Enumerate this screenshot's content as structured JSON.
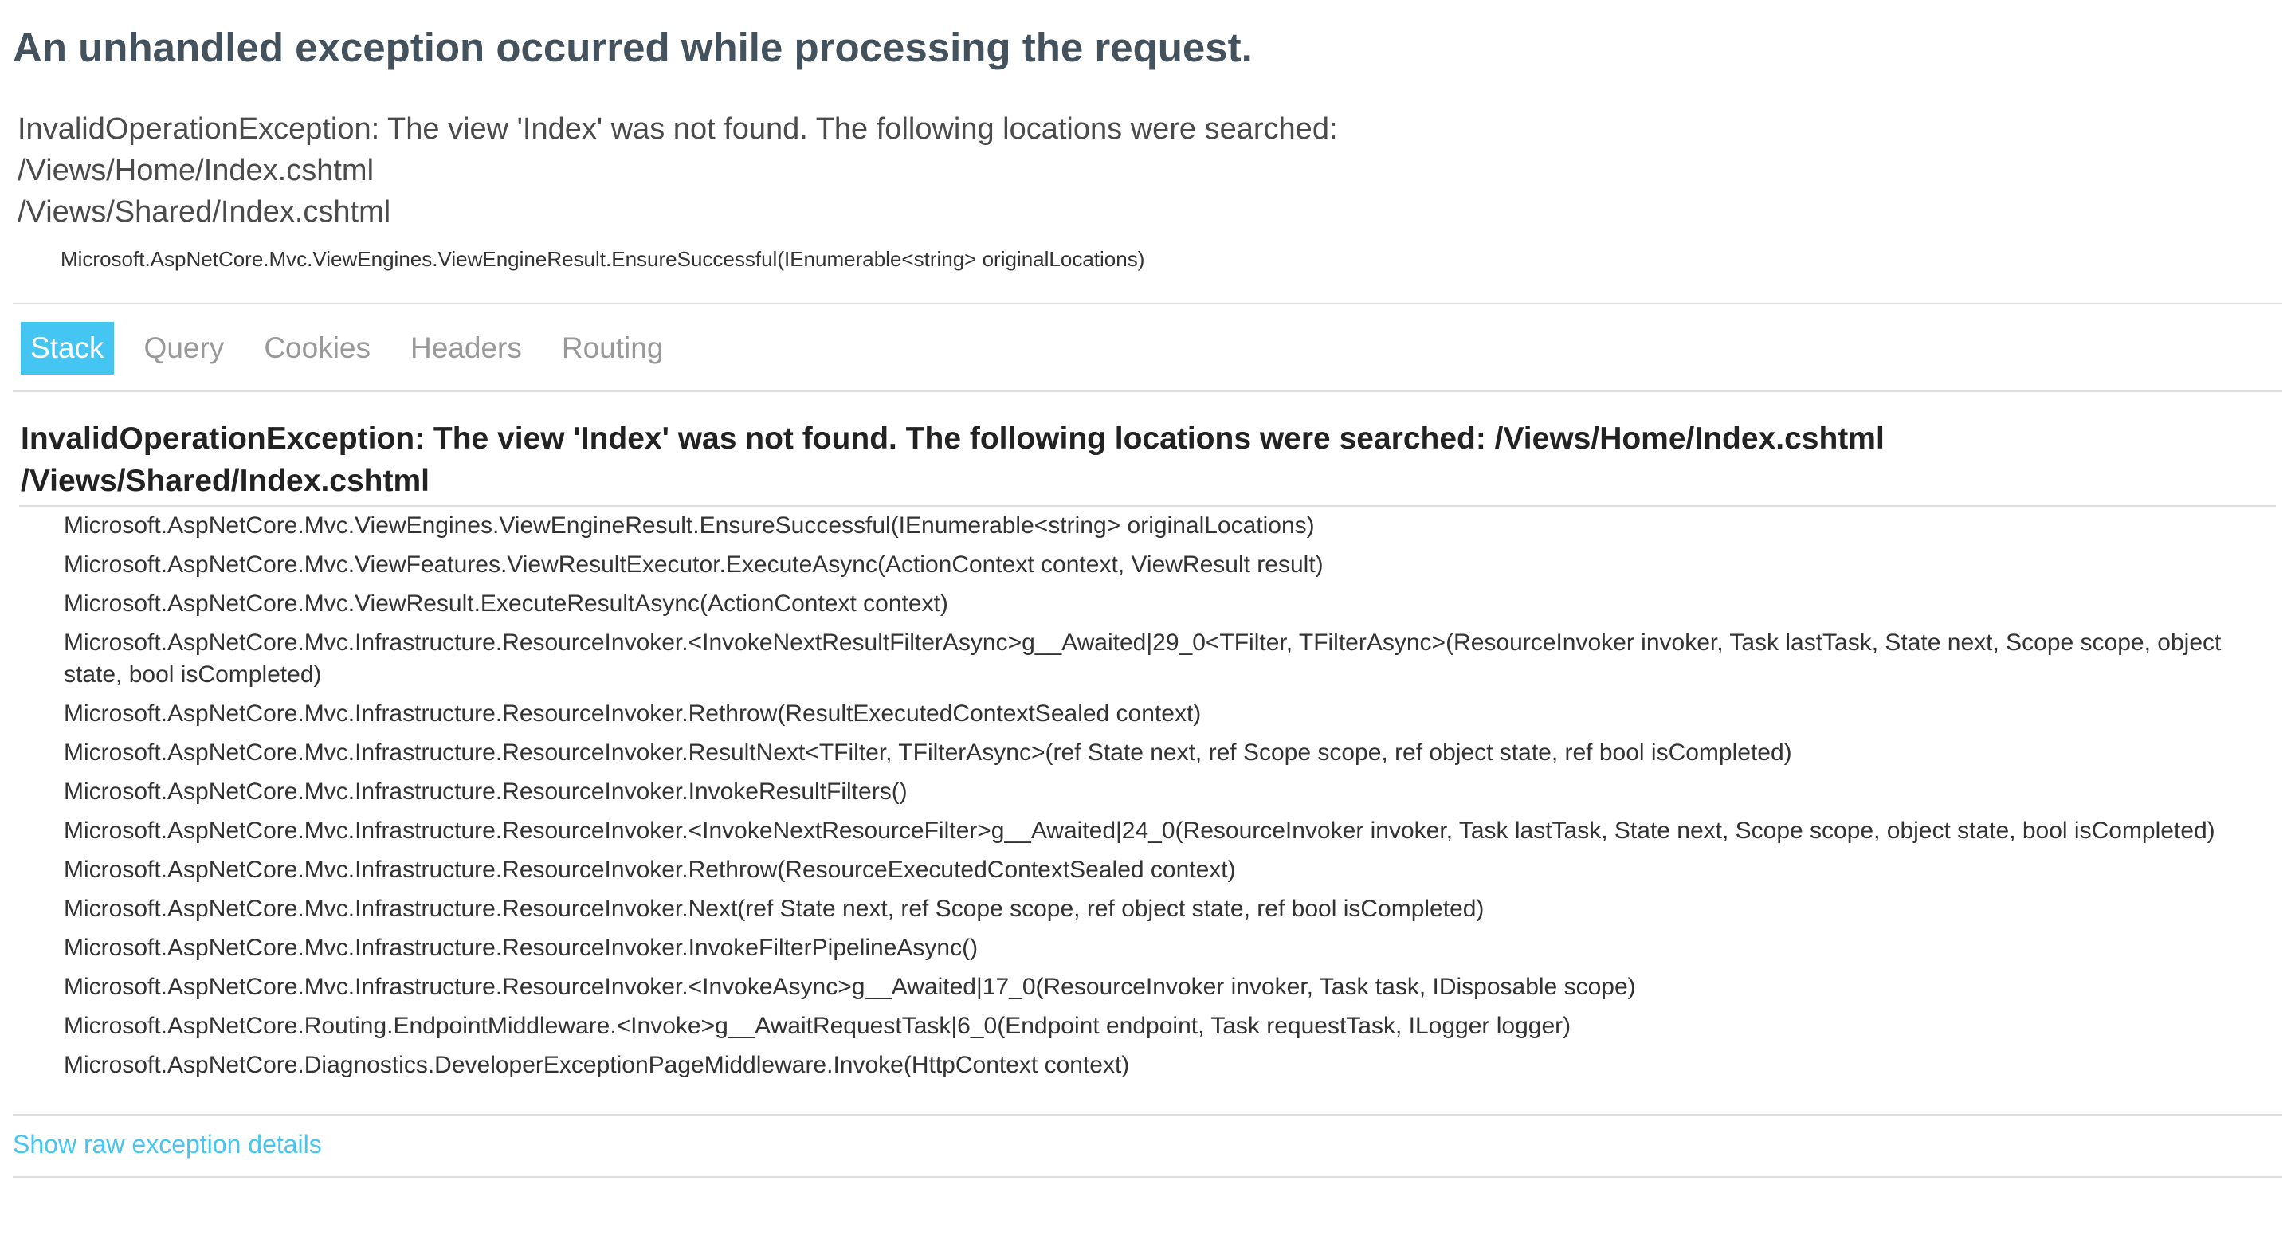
{
  "page": {
    "title": "An unhandled exception occurred while processing the request."
  },
  "summary": {
    "lines": [
      "InvalidOperationException: The view 'Index' was not found. The following locations were searched:",
      "/Views/Home/Index.cshtml",
      "/Views/Shared/Index.cshtml"
    ],
    "location": "Microsoft.AspNetCore.Mvc.ViewEngines.ViewEngineResult.EnsureSuccessful(IEnumerable<string> originalLocations)"
  },
  "tabs": {
    "items": [
      "Stack",
      "Query",
      "Cookies",
      "Headers",
      "Routing"
    ],
    "selected": "Stack",
    "selected_color": "#44c5f2"
  },
  "stack": {
    "exception_title": "InvalidOperationException: The view 'Index' was not found. The following locations were searched: /Views/Home/Index.cshtml /Views/Shared/Index.cshtml",
    "frames": [
      "Microsoft.AspNetCore.Mvc.ViewEngines.ViewEngineResult.EnsureSuccessful(IEnumerable<string> originalLocations)",
      "Microsoft.AspNetCore.Mvc.ViewFeatures.ViewResultExecutor.ExecuteAsync(ActionContext context, ViewResult result)",
      "Microsoft.AspNetCore.Mvc.ViewResult.ExecuteResultAsync(ActionContext context)",
      "Microsoft.AspNetCore.Mvc.Infrastructure.ResourceInvoker.<InvokeNextResultFilterAsync>g__Awaited|29_0<TFilter, TFilterAsync>(ResourceInvoker invoker, Task lastTask, State next, Scope scope, object state, bool isCompleted)",
      "Microsoft.AspNetCore.Mvc.Infrastructure.ResourceInvoker.Rethrow(ResultExecutedContextSealed context)",
      "Microsoft.AspNetCore.Mvc.Infrastructure.ResourceInvoker.ResultNext<TFilter, TFilterAsync>(ref State next, ref Scope scope, ref object state, ref bool isCompleted)",
      "Microsoft.AspNetCore.Mvc.Infrastructure.ResourceInvoker.InvokeResultFilters()",
      "Microsoft.AspNetCore.Mvc.Infrastructure.ResourceInvoker.<InvokeNextResourceFilter>g__Awaited|24_0(ResourceInvoker invoker, Task lastTask, State next, Scope scope, object state, bool isCompleted)",
      "Microsoft.AspNetCore.Mvc.Infrastructure.ResourceInvoker.Rethrow(ResourceExecutedContextSealed context)",
      "Microsoft.AspNetCore.Mvc.Infrastructure.ResourceInvoker.Next(ref State next, ref Scope scope, ref object state, ref bool isCompleted)",
      "Microsoft.AspNetCore.Mvc.Infrastructure.ResourceInvoker.InvokeFilterPipelineAsync()",
      "Microsoft.AspNetCore.Mvc.Infrastructure.ResourceInvoker.<InvokeAsync>g__Awaited|17_0(ResourceInvoker invoker, Task task, IDisposable scope)",
      "Microsoft.AspNetCore.Routing.EndpointMiddleware.<Invoke>g__AwaitRequestTask|6_0(Endpoint endpoint, Task requestTask, ILogger logger)",
      "Microsoft.AspNetCore.Diagnostics.DeveloperExceptionPageMiddleware.Invoke(HttpContext context)"
    ]
  },
  "footer": {
    "raw_link": "Show raw exception details",
    "link_color": "#44c5f2"
  }
}
